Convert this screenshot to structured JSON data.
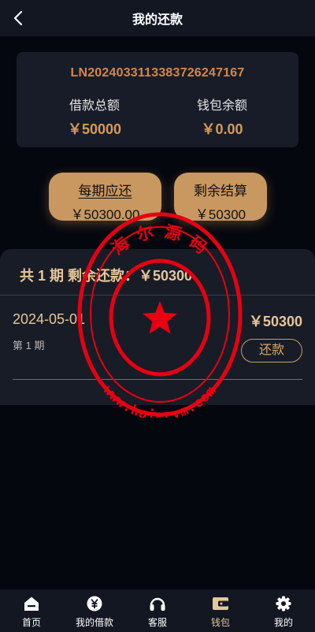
{
  "header": {
    "title": "我的还款"
  },
  "loan": {
    "number": "LN2024033113383726247167",
    "total_label": "借款总额",
    "total_value": "￥50000",
    "wallet_label": "钱包余额",
    "wallet_value": "￥0.00"
  },
  "pills": [
    {
      "title": "每期应还",
      "value": "￥50300.00"
    },
    {
      "title": "剩余结算",
      "value": "￥50300"
    }
  ],
  "plan": {
    "summary": "共 1 期 剩余还款：￥50300",
    "rows": [
      {
        "date": "2024-05-01",
        "amount": "￥50300",
        "period": "第 1 期",
        "action": "还款"
      }
    ]
  },
  "watermark": {
    "text": "海 尔 源 码",
    "url": "www.haierym.com",
    "color": "#e60012"
  },
  "tabs": [
    {
      "label": "首页",
      "icon": "home-icon"
    },
    {
      "label": "我的借款",
      "icon": "yuan-coin-icon"
    },
    {
      "label": "客服",
      "icon": "headset-icon"
    },
    {
      "label": "钱包",
      "icon": "wallet-icon",
      "active": true
    },
    {
      "label": "我的",
      "icon": "gear-icon"
    }
  ],
  "colors": {
    "accent": "#c89860",
    "accent_text": "#e6c79a",
    "loan_number": "#d2884b",
    "background": "#05070f"
  }
}
